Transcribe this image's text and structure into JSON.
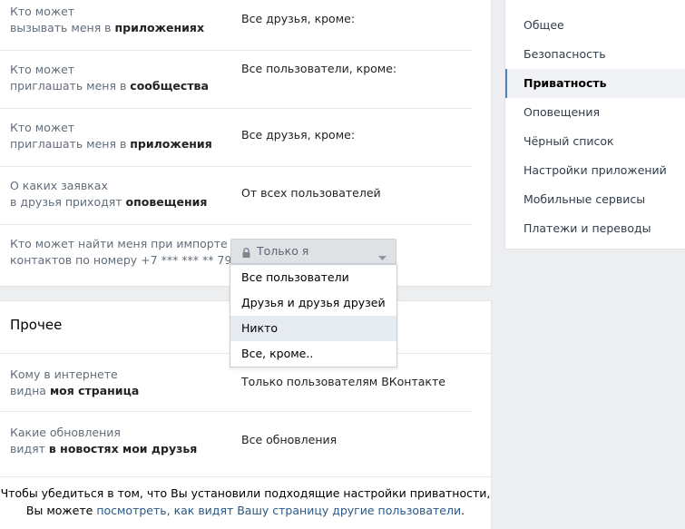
{
  "settings_rows": [
    {
      "q_pre": "Кто может",
      "q_line2_pre": "вызывать меня в ",
      "q_bold": "приложениях",
      "value": "Все друзья, кроме:"
    },
    {
      "q_pre": "Кто может",
      "q_line2_pre": "приглашать меня в ",
      "q_bold": "сообщества",
      "value": "Все пользователи, кроме:"
    },
    {
      "q_pre": "Кто может",
      "q_line2_pre": "приглашать меня в ",
      "q_bold": "приложения",
      "value": "Все друзья, кроме:"
    },
    {
      "q_pre": "О каких заявках",
      "q_line2_pre": "в друзья приходят ",
      "q_bold": "оповещения",
      "value": "От всех пользователей"
    },
    {
      "q_pre": "Кто может найти меня при импорте",
      "q_line2_pre": "контактов по номеру +7 *** *** ** 79",
      "q_bold": "",
      "value": ""
    }
  ],
  "dropdown": {
    "selected": "Только я",
    "options": [
      "Все пользователи",
      "Друзья и друзья друзей",
      "Никто",
      "Все, кроме.."
    ],
    "highlighted_index": 2
  },
  "other": {
    "title": "Прочее",
    "rows": [
      {
        "q_pre": "Кому в интернете",
        "q_line2_pre": "видна ",
        "q_bold": "моя страница",
        "value": "Только пользователям ВКонтакте"
      },
      {
        "q_pre": "Какие обновления",
        "q_line2_pre": "видят ",
        "q_bold": "в новостях мои друзья",
        "value": "Все обновления"
      }
    ]
  },
  "footer": {
    "line1": "Чтобы убедиться в том, что Вы установили подходящие настройки приватности,",
    "line2_pre": "Вы можете ",
    "line2_link": "посмотреть, как видят Вашу страницу другие пользователи",
    "line2_post": "."
  },
  "sidebar": {
    "items": [
      "Общее",
      "Безопасность",
      "Приватность",
      "Оповещения",
      "Чёрный список",
      "Настройки приложений",
      "Мобильные сервисы",
      "Платежи и переводы"
    ],
    "active_index": 2
  },
  "colors": {
    "accent": "#5181b8",
    "link": "#2a5885",
    "highlight": "#e5ebf1"
  },
  "icons": {
    "lock": "lock-icon",
    "chevron": "chevron-down-icon"
  }
}
